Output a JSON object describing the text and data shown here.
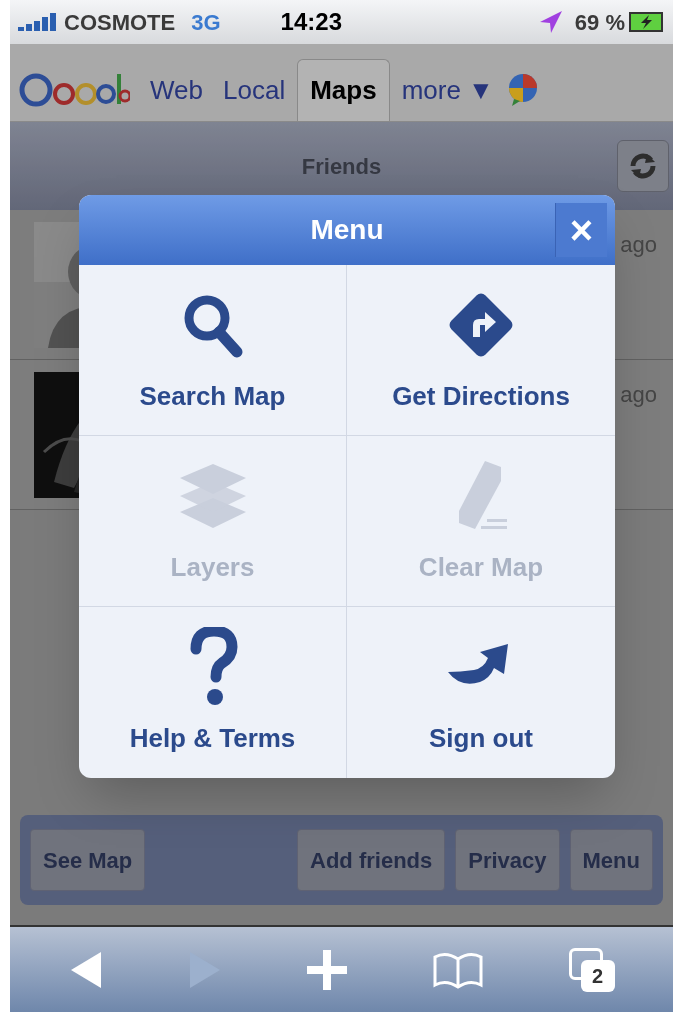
{
  "status_bar": {
    "carrier": "COSMOTE",
    "network": "3G",
    "time": "14:23",
    "battery": "69 %"
  },
  "google_nav": {
    "links": [
      {
        "label": "Web",
        "selected": false
      },
      {
        "label": "Local",
        "selected": false
      },
      {
        "label": "Maps",
        "selected": true
      },
      {
        "label": "more ▼",
        "selected": false
      }
    ]
  },
  "friends_bar": {
    "title": "Friends"
  },
  "friends": [
    {
      "time": "ago"
    },
    {
      "time": "ago"
    }
  ],
  "menu": {
    "title": "Menu",
    "close": "×",
    "items": [
      {
        "label": "Search Map",
        "kind": "search",
        "disabled": false
      },
      {
        "label": "Get Directions",
        "kind": "directions",
        "disabled": false
      },
      {
        "label": "Layers",
        "kind": "layers",
        "disabled": true
      },
      {
        "label": "Clear Map",
        "kind": "clear",
        "disabled": true
      },
      {
        "label": "Help & Terms",
        "kind": "help",
        "disabled": false
      },
      {
        "label": "Sign out",
        "kind": "signout",
        "disabled": false
      }
    ]
  },
  "bottom_buttons": [
    "See Map",
    "Add friends",
    "Privacy",
    "Menu"
  ],
  "browser_toolbar": {
    "tabs_count": "2"
  }
}
